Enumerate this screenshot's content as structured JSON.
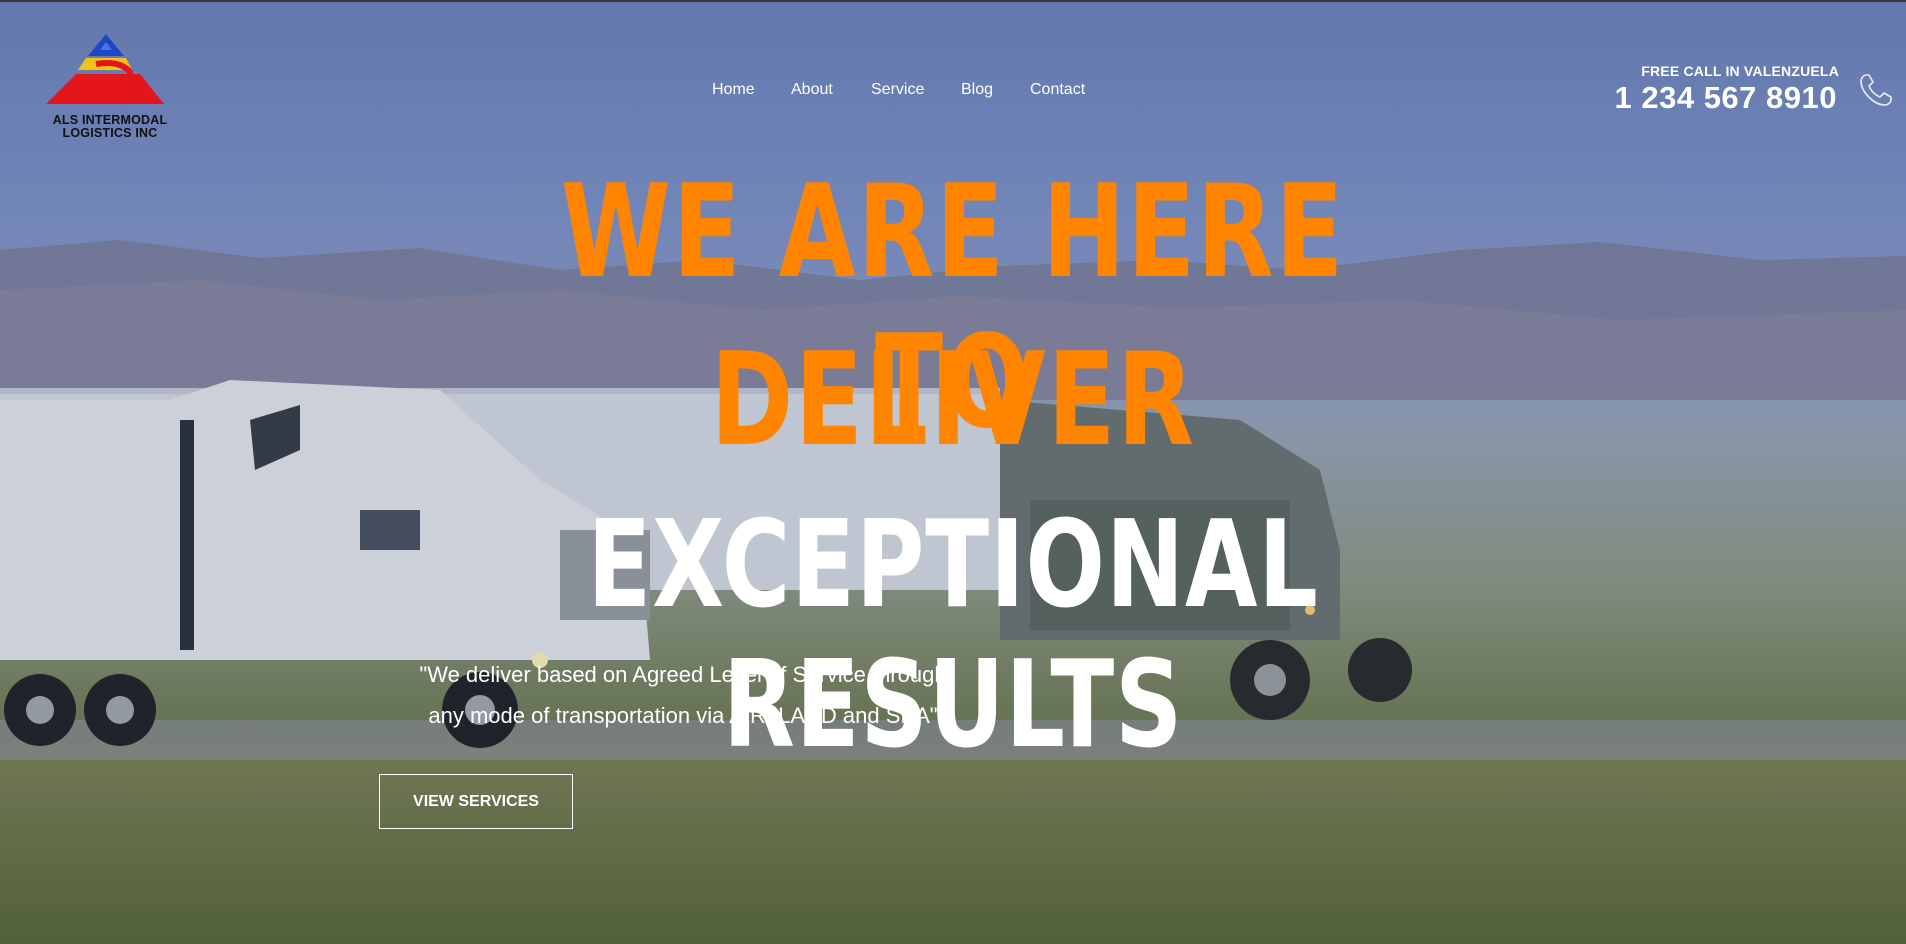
{
  "logo": {
    "line1": "ALS INTERMODAL",
    "line2": "LOGISTICS INC",
    "colors": {
      "blue": "#1e46c8",
      "yellow": "#f2c21a",
      "red": "#e3161b"
    }
  },
  "nav": {
    "items": [
      {
        "label": "Home"
      },
      {
        "label": "About"
      },
      {
        "label": "Service"
      },
      {
        "label": "Blog"
      },
      {
        "label": "Contact"
      }
    ]
  },
  "contact": {
    "label": "FREE CALL IN VALENZUELA",
    "phone": "1 234 567 8910",
    "icon": "phone-icon"
  },
  "hero": {
    "line1": "WE ARE HERE TO",
    "line2": "DELIVER",
    "line3": "EXCEPTIONAL RESULTS",
    "quote_line1": "\"We deliver based on Agreed Level of Service through",
    "quote_line2": "any mode of transportation via AIR, LAND and SEA\"",
    "button_label": "VIEW SERVICES",
    "accent_color": "#ff8500"
  }
}
